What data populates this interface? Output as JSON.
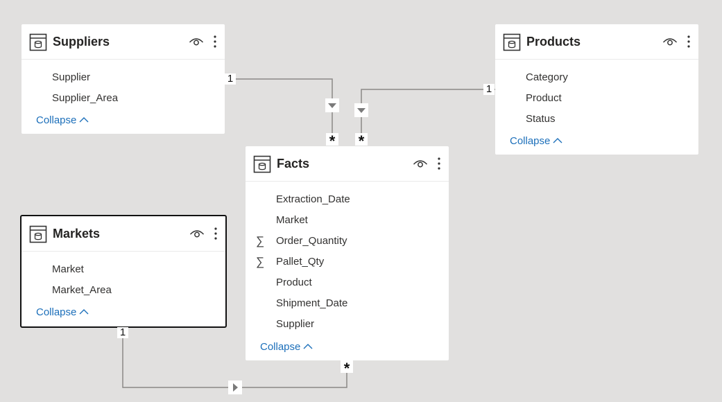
{
  "tables": {
    "suppliers": {
      "title": "Suppliers",
      "fields": [
        {
          "name": "Supplier"
        },
        {
          "name": "Supplier_Area"
        }
      ],
      "collapse_label": "Collapse"
    },
    "products": {
      "title": "Products",
      "fields": [
        {
          "name": "Category"
        },
        {
          "name": "Product"
        },
        {
          "name": "Status"
        }
      ],
      "collapse_label": "Collapse"
    },
    "facts": {
      "title": "Facts",
      "fields": [
        {
          "name": "Extraction_Date"
        },
        {
          "name": "Market"
        },
        {
          "name": "Order_Quantity",
          "icon": "∑"
        },
        {
          "name": "Pallet_Qty",
          "icon": "∑"
        },
        {
          "name": "Product"
        },
        {
          "name": "Shipment_Date"
        },
        {
          "name": "Supplier"
        }
      ],
      "collapse_label": "Collapse"
    },
    "markets": {
      "title": "Markets",
      "fields": [
        {
          "name": "Market"
        },
        {
          "name": "Market_Area"
        }
      ],
      "collapse_label": "Collapse"
    }
  },
  "relationships": {
    "suppliers_facts": {
      "one_label": "1",
      "many_label": "*"
    },
    "products_facts": {
      "one_label": "1",
      "many_label": "*"
    },
    "markets_facts": {
      "one_label": "1",
      "many_label": "*"
    }
  },
  "colors": {
    "canvas": "#e1e0df",
    "link_text": "#1c6fba",
    "relationship_line": "#8a8886",
    "selected_border": "#111111"
  }
}
